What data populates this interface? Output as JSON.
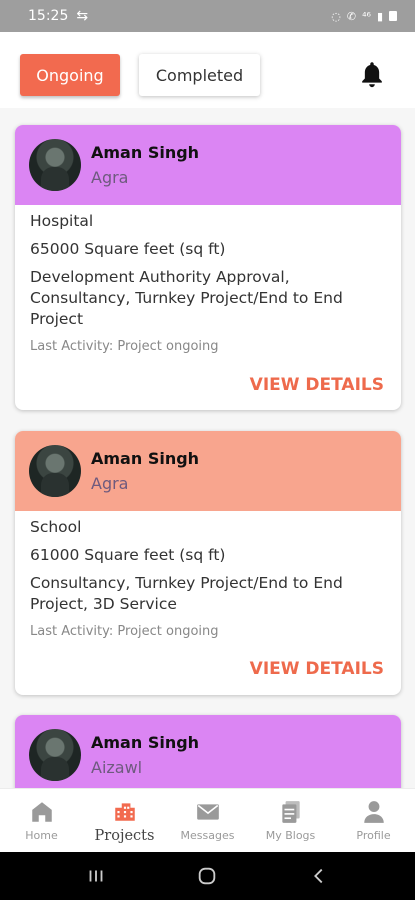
{
  "status": {
    "time": "15:25",
    "sub": "⁴⁶"
  },
  "tabs": {
    "ongoing": "Ongoing",
    "completed": "Completed"
  },
  "projects": [
    {
      "name": "Aman Singh",
      "city": "Agra",
      "type": "Hospital",
      "area": "65000 Square feet (sq ft)",
      "services": "Development Authority Approval, Consultancy, Turnkey Project/End to End Project",
      "activity": "Last Activity: Project ongoing",
      "action": "VIEW DETAILS",
      "header_color": "#db85f3"
    },
    {
      "name": "Aman Singh",
      "city": "Agra",
      "type": "School",
      "area": "61000 Square feet (sq ft)",
      "services": "Consultancy, Turnkey Project/End to End Project, 3D Service",
      "activity": "Last Activity: Project ongoing",
      "action": "VIEW DETAILS",
      "header_color": "#f8a58e"
    },
    {
      "name": "Aman Singh",
      "city": "Aizawl",
      "header_color": "#db85f3"
    }
  ],
  "nav": {
    "home": "Home",
    "projects": "Projects",
    "messages": "Messages",
    "blogs": "My Blogs",
    "profile": "Profile"
  },
  "colors": {
    "accent": "#f26a4f",
    "status_bar": "#9e9e9e"
  }
}
